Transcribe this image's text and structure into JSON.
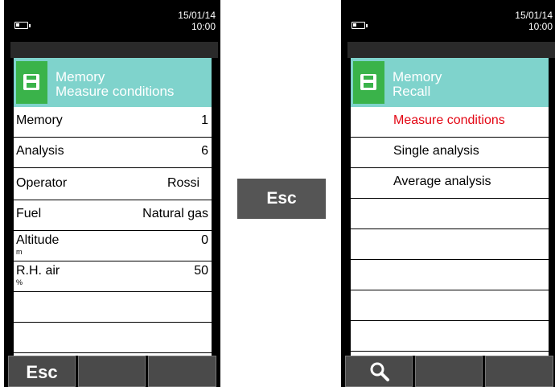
{
  "left_screen": {
    "status": {
      "date": "15/01/14",
      "time": "10:00"
    },
    "header": {
      "line1": "Memory",
      "line2": "Measure conditions"
    },
    "rows": [
      {
        "label": "Memory",
        "value": "1"
      },
      {
        "label": "Analysis",
        "value": "6"
      },
      {
        "label": "Operator",
        "value": "Rossi"
      },
      {
        "label": "Fuel",
        "value": "Natural gas"
      },
      {
        "label": "Altitude",
        "value": "0",
        "unit": "m"
      },
      {
        "label": "R.H. air",
        "value": "50",
        "unit": "%"
      }
    ],
    "softkeys": [
      "Esc",
      "",
      ""
    ]
  },
  "middle_key": {
    "label": "Esc"
  },
  "right_screen": {
    "status": {
      "date": "15/01/14",
      "time": "10:00"
    },
    "header": {
      "line1": "Memory",
      "line2": "Recall"
    },
    "menu": [
      {
        "label": "Measure conditions",
        "selected": true
      },
      {
        "label": "Single analysis"
      },
      {
        "label": "Average analysis"
      }
    ],
    "softkeys": [
      "search-icon",
      "",
      ""
    ]
  },
  "colors": {
    "header_bg": "#7fd3cc",
    "icon_bg": "#3ab34a",
    "selected_text": "#e30613",
    "softkey_bg": "#4a4a4a",
    "middle_key_bg": "#555555"
  }
}
